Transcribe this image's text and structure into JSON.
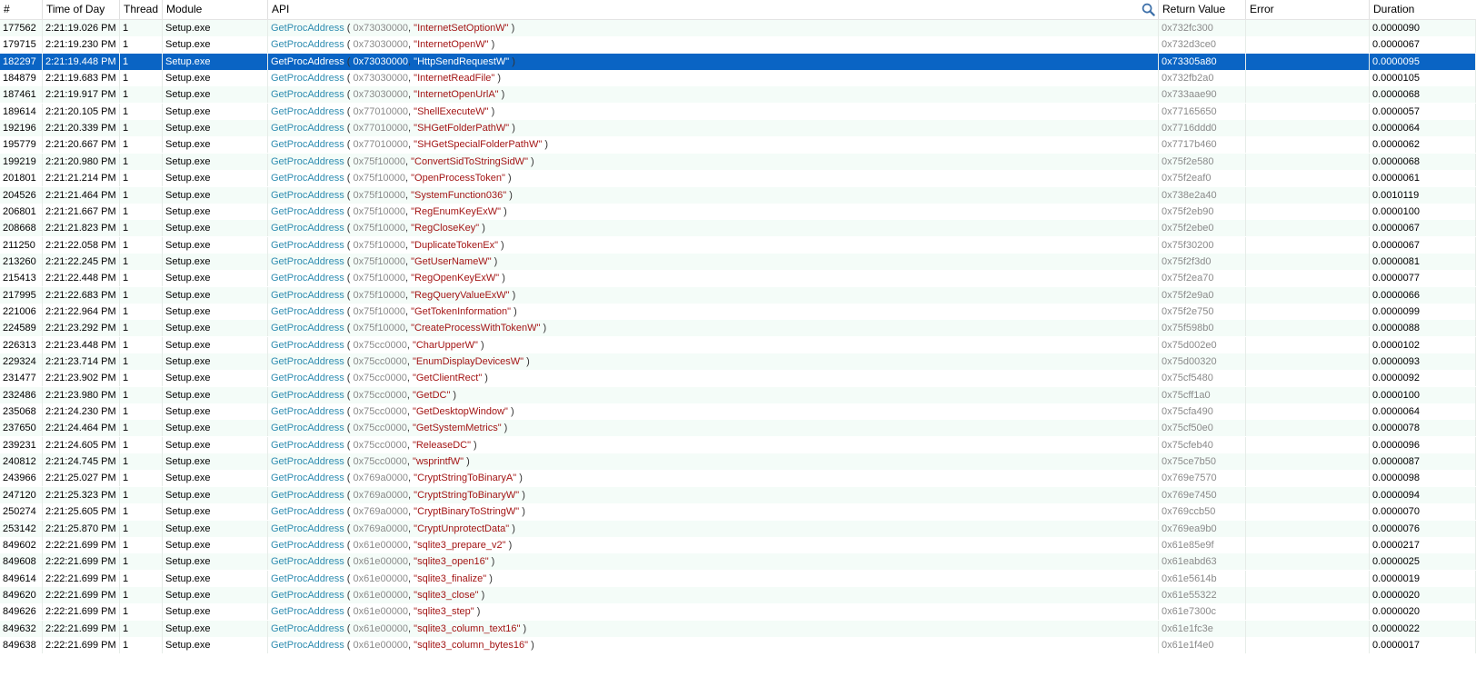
{
  "columns": {
    "num": "#",
    "time": "Time of Day",
    "thread": "Thread",
    "module": "Module",
    "api": "API",
    "ret": "Return Value",
    "error": "Error",
    "duration": "Duration"
  },
  "search_icon": "search-icon",
  "selected_index": 2,
  "colors": {
    "selection": "#0a64c4",
    "function": "#2e8cb0",
    "string_arg": "#a31515",
    "address": "#8a8a8a",
    "row_alt": "#f4fcf8"
  },
  "rows": [
    {
      "num": "177562",
      "time": "2:21:19.026 PM",
      "thread": "1",
      "module": "Setup.exe",
      "fn": "GetProcAddress",
      "addr": "0x73030000",
      "arg": "\"InternetSetOptionW\"",
      "ret": "0x732fc300",
      "error": "",
      "duration": "0.0000090"
    },
    {
      "num": "179715",
      "time": "2:21:19.230 PM",
      "thread": "1",
      "module": "Setup.exe",
      "fn": "GetProcAddress",
      "addr": "0x73030000",
      "arg": "\"InternetOpenW\"",
      "ret": "0x732d3ce0",
      "error": "",
      "duration": "0.0000067"
    },
    {
      "num": "182297",
      "time": "2:21:19.448 PM",
      "thread": "1",
      "module": "Setup.exe",
      "fn": "GetProcAddress",
      "addr": "0x73030000",
      "arg": "\"HttpSendRequestW\"",
      "ret": "0x73305a80",
      "error": "",
      "duration": "0.0000095"
    },
    {
      "num": "184879",
      "time": "2:21:19.683 PM",
      "thread": "1",
      "module": "Setup.exe",
      "fn": "GetProcAddress",
      "addr": "0x73030000",
      "arg": "\"InternetReadFile\"",
      "ret": "0x732fb2a0",
      "error": "",
      "duration": "0.0000105"
    },
    {
      "num": "187461",
      "time": "2:21:19.917 PM",
      "thread": "1",
      "module": "Setup.exe",
      "fn": "GetProcAddress",
      "addr": "0x73030000",
      "arg": "\"InternetOpenUrlA\"",
      "ret": "0x733aae90",
      "error": "",
      "duration": "0.0000068"
    },
    {
      "num": "189614",
      "time": "2:21:20.105 PM",
      "thread": "1",
      "module": "Setup.exe",
      "fn": "GetProcAddress",
      "addr": "0x77010000",
      "arg": "\"ShellExecuteW\"",
      "ret": "0x77165650",
      "error": "",
      "duration": "0.0000057"
    },
    {
      "num": "192196",
      "time": "2:21:20.339 PM",
      "thread": "1",
      "module": "Setup.exe",
      "fn": "GetProcAddress",
      "addr": "0x77010000",
      "arg": "\"SHGetFolderPathW\"",
      "ret": "0x7716ddd0",
      "error": "",
      "duration": "0.0000064"
    },
    {
      "num": "195779",
      "time": "2:21:20.667 PM",
      "thread": "1",
      "module": "Setup.exe",
      "fn": "GetProcAddress",
      "addr": "0x77010000",
      "arg": "\"SHGetSpecialFolderPathW\"",
      "ret": "0x7717b460",
      "error": "",
      "duration": "0.0000062"
    },
    {
      "num": "199219",
      "time": "2:21:20.980 PM",
      "thread": "1",
      "module": "Setup.exe",
      "fn": "GetProcAddress",
      "addr": "0x75f10000",
      "arg": "\"ConvertSidToStringSidW\"",
      "ret": "0x75f2e580",
      "error": "",
      "duration": "0.0000068"
    },
    {
      "num": "201801",
      "time": "2:21:21.214 PM",
      "thread": "1",
      "module": "Setup.exe",
      "fn": "GetProcAddress",
      "addr": "0x75f10000",
      "arg": "\"OpenProcessToken\"",
      "ret": "0x75f2eaf0",
      "error": "",
      "duration": "0.0000061"
    },
    {
      "num": "204526",
      "time": "2:21:21.464 PM",
      "thread": "1",
      "module": "Setup.exe",
      "fn": "GetProcAddress",
      "addr": "0x75f10000",
      "arg": "\"SystemFunction036\"",
      "ret": "0x738e2a40",
      "error": "",
      "duration": "0.0010119"
    },
    {
      "num": "206801",
      "time": "2:21:21.667 PM",
      "thread": "1",
      "module": "Setup.exe",
      "fn": "GetProcAddress",
      "addr": "0x75f10000",
      "arg": "\"RegEnumKeyExW\"",
      "ret": "0x75f2eb90",
      "error": "",
      "duration": "0.0000100"
    },
    {
      "num": "208668",
      "time": "2:21:21.823 PM",
      "thread": "1",
      "module": "Setup.exe",
      "fn": "GetProcAddress",
      "addr": "0x75f10000",
      "arg": "\"RegCloseKey\"",
      "ret": "0x75f2ebe0",
      "error": "",
      "duration": "0.0000067"
    },
    {
      "num": "211250",
      "time": "2:21:22.058 PM",
      "thread": "1",
      "module": "Setup.exe",
      "fn": "GetProcAddress",
      "addr": "0x75f10000",
      "arg": "\"DuplicateTokenEx\"",
      "ret": "0x75f30200",
      "error": "",
      "duration": "0.0000067"
    },
    {
      "num": "213260",
      "time": "2:21:22.245 PM",
      "thread": "1",
      "module": "Setup.exe",
      "fn": "GetProcAddress",
      "addr": "0x75f10000",
      "arg": "\"GetUserNameW\"",
      "ret": "0x75f2f3d0",
      "error": "",
      "duration": "0.0000081"
    },
    {
      "num": "215413",
      "time": "2:21:22.448 PM",
      "thread": "1",
      "module": "Setup.exe",
      "fn": "GetProcAddress",
      "addr": "0x75f10000",
      "arg": "\"RegOpenKeyExW\"",
      "ret": "0x75f2ea70",
      "error": "",
      "duration": "0.0000077"
    },
    {
      "num": "217995",
      "time": "2:21:22.683 PM",
      "thread": "1",
      "module": "Setup.exe",
      "fn": "GetProcAddress",
      "addr": "0x75f10000",
      "arg": "\"RegQueryValueExW\"",
      "ret": "0x75f2e9a0",
      "error": "",
      "duration": "0.0000066"
    },
    {
      "num": "221006",
      "time": "2:21:22.964 PM",
      "thread": "1",
      "module": "Setup.exe",
      "fn": "GetProcAddress",
      "addr": "0x75f10000",
      "arg": "\"GetTokenInformation\"",
      "ret": "0x75f2e750",
      "error": "",
      "duration": "0.0000099"
    },
    {
      "num": "224589",
      "time": "2:21:23.292 PM",
      "thread": "1",
      "module": "Setup.exe",
      "fn": "GetProcAddress",
      "addr": "0x75f10000",
      "arg": "\"CreateProcessWithTokenW\"",
      "ret": "0x75f598b0",
      "error": "",
      "duration": "0.0000088"
    },
    {
      "num": "226313",
      "time": "2:21:23.448 PM",
      "thread": "1",
      "module": "Setup.exe",
      "fn": "GetProcAddress",
      "addr": "0x75cc0000",
      "arg": "\"CharUpperW\"",
      "ret": "0x75d002e0",
      "error": "",
      "duration": "0.0000102"
    },
    {
      "num": "229324",
      "time": "2:21:23.714 PM",
      "thread": "1",
      "module": "Setup.exe",
      "fn": "GetProcAddress",
      "addr": "0x75cc0000",
      "arg": "\"EnumDisplayDevicesW\"",
      "ret": "0x75d00320",
      "error": "",
      "duration": "0.0000093"
    },
    {
      "num": "231477",
      "time": "2:21:23.902 PM",
      "thread": "1",
      "module": "Setup.exe",
      "fn": "GetProcAddress",
      "addr": "0x75cc0000",
      "arg": "\"GetClientRect\"",
      "ret": "0x75cf5480",
      "error": "",
      "duration": "0.0000092"
    },
    {
      "num": "232486",
      "time": "2:21:23.980 PM",
      "thread": "1",
      "module": "Setup.exe",
      "fn": "GetProcAddress",
      "addr": "0x75cc0000",
      "arg": "\"GetDC\"",
      "ret": "0x75cff1a0",
      "error": "",
      "duration": "0.0000100"
    },
    {
      "num": "235068",
      "time": "2:21:24.230 PM",
      "thread": "1",
      "module": "Setup.exe",
      "fn": "GetProcAddress",
      "addr": "0x75cc0000",
      "arg": "\"GetDesktopWindow\"",
      "ret": "0x75cfa490",
      "error": "",
      "duration": "0.0000064"
    },
    {
      "num": "237650",
      "time": "2:21:24.464 PM",
      "thread": "1",
      "module": "Setup.exe",
      "fn": "GetProcAddress",
      "addr": "0x75cc0000",
      "arg": "\"GetSystemMetrics\"",
      "ret": "0x75cf50e0",
      "error": "",
      "duration": "0.0000078"
    },
    {
      "num": "239231",
      "time": "2:21:24.605 PM",
      "thread": "1",
      "module": "Setup.exe",
      "fn": "GetProcAddress",
      "addr": "0x75cc0000",
      "arg": "\"ReleaseDC\"",
      "ret": "0x75cfeb40",
      "error": "",
      "duration": "0.0000096"
    },
    {
      "num": "240812",
      "time": "2:21:24.745 PM",
      "thread": "1",
      "module": "Setup.exe",
      "fn": "GetProcAddress",
      "addr": "0x75cc0000",
      "arg": "\"wsprintfW\"",
      "ret": "0x75ce7b50",
      "error": "",
      "duration": "0.0000087"
    },
    {
      "num": "243966",
      "time": "2:21:25.027 PM",
      "thread": "1",
      "module": "Setup.exe",
      "fn": "GetProcAddress",
      "addr": "0x769a0000",
      "arg": "\"CryptStringToBinaryA\"",
      "ret": "0x769e7570",
      "error": "",
      "duration": "0.0000098"
    },
    {
      "num": "247120",
      "time": "2:21:25.323 PM",
      "thread": "1",
      "module": "Setup.exe",
      "fn": "GetProcAddress",
      "addr": "0x769a0000",
      "arg": "\"CryptStringToBinaryW\"",
      "ret": "0x769e7450",
      "error": "",
      "duration": "0.0000094"
    },
    {
      "num": "250274",
      "time": "2:21:25.605 PM",
      "thread": "1",
      "module": "Setup.exe",
      "fn": "GetProcAddress",
      "addr": "0x769a0000",
      "arg": "\"CryptBinaryToStringW\"",
      "ret": "0x769ccb50",
      "error": "",
      "duration": "0.0000070"
    },
    {
      "num": "253142",
      "time": "2:21:25.870 PM",
      "thread": "1",
      "module": "Setup.exe",
      "fn": "GetProcAddress",
      "addr": "0x769a0000",
      "arg": "\"CryptUnprotectData\"",
      "ret": "0x769ea9b0",
      "error": "",
      "duration": "0.0000076"
    },
    {
      "num": "849602",
      "time": "2:22:21.699 PM",
      "thread": "1",
      "module": "Setup.exe",
      "fn": "GetProcAddress",
      "addr": "0x61e00000",
      "arg": "\"sqlite3_prepare_v2\"",
      "ret": "0x61e85e9f",
      "error": "",
      "duration": "0.0000217"
    },
    {
      "num": "849608",
      "time": "2:22:21.699 PM",
      "thread": "1",
      "module": "Setup.exe",
      "fn": "GetProcAddress",
      "addr": "0x61e00000",
      "arg": "\"sqlite3_open16\"",
      "ret": "0x61eabd63",
      "error": "",
      "duration": "0.0000025"
    },
    {
      "num": "849614",
      "time": "2:22:21.699 PM",
      "thread": "1",
      "module": "Setup.exe",
      "fn": "GetProcAddress",
      "addr": "0x61e00000",
      "arg": "\"sqlite3_finalize\"",
      "ret": "0x61e5614b",
      "error": "",
      "duration": "0.0000019"
    },
    {
      "num": "849620",
      "time": "2:22:21.699 PM",
      "thread": "1",
      "module": "Setup.exe",
      "fn": "GetProcAddress",
      "addr": "0x61e00000",
      "arg": "\"sqlite3_close\"",
      "ret": "0x61e55322",
      "error": "",
      "duration": "0.0000020"
    },
    {
      "num": "849626",
      "time": "2:22:21.699 PM",
      "thread": "1",
      "module": "Setup.exe",
      "fn": "GetProcAddress",
      "addr": "0x61e00000",
      "arg": "\"sqlite3_step\"",
      "ret": "0x61e7300c",
      "error": "",
      "duration": "0.0000020"
    },
    {
      "num": "849632",
      "time": "2:22:21.699 PM",
      "thread": "1",
      "module": "Setup.exe",
      "fn": "GetProcAddress",
      "addr": "0x61e00000",
      "arg": "\"sqlite3_column_text16\"",
      "ret": "0x61e1fc3e",
      "error": "",
      "duration": "0.0000022"
    },
    {
      "num": "849638",
      "time": "2:22:21.699 PM",
      "thread": "1",
      "module": "Setup.exe",
      "fn": "GetProcAddress",
      "addr": "0x61e00000",
      "arg": "\"sqlite3_column_bytes16\"",
      "ret": "0x61e1f4e0",
      "error": "",
      "duration": "0.0000017"
    }
  ]
}
